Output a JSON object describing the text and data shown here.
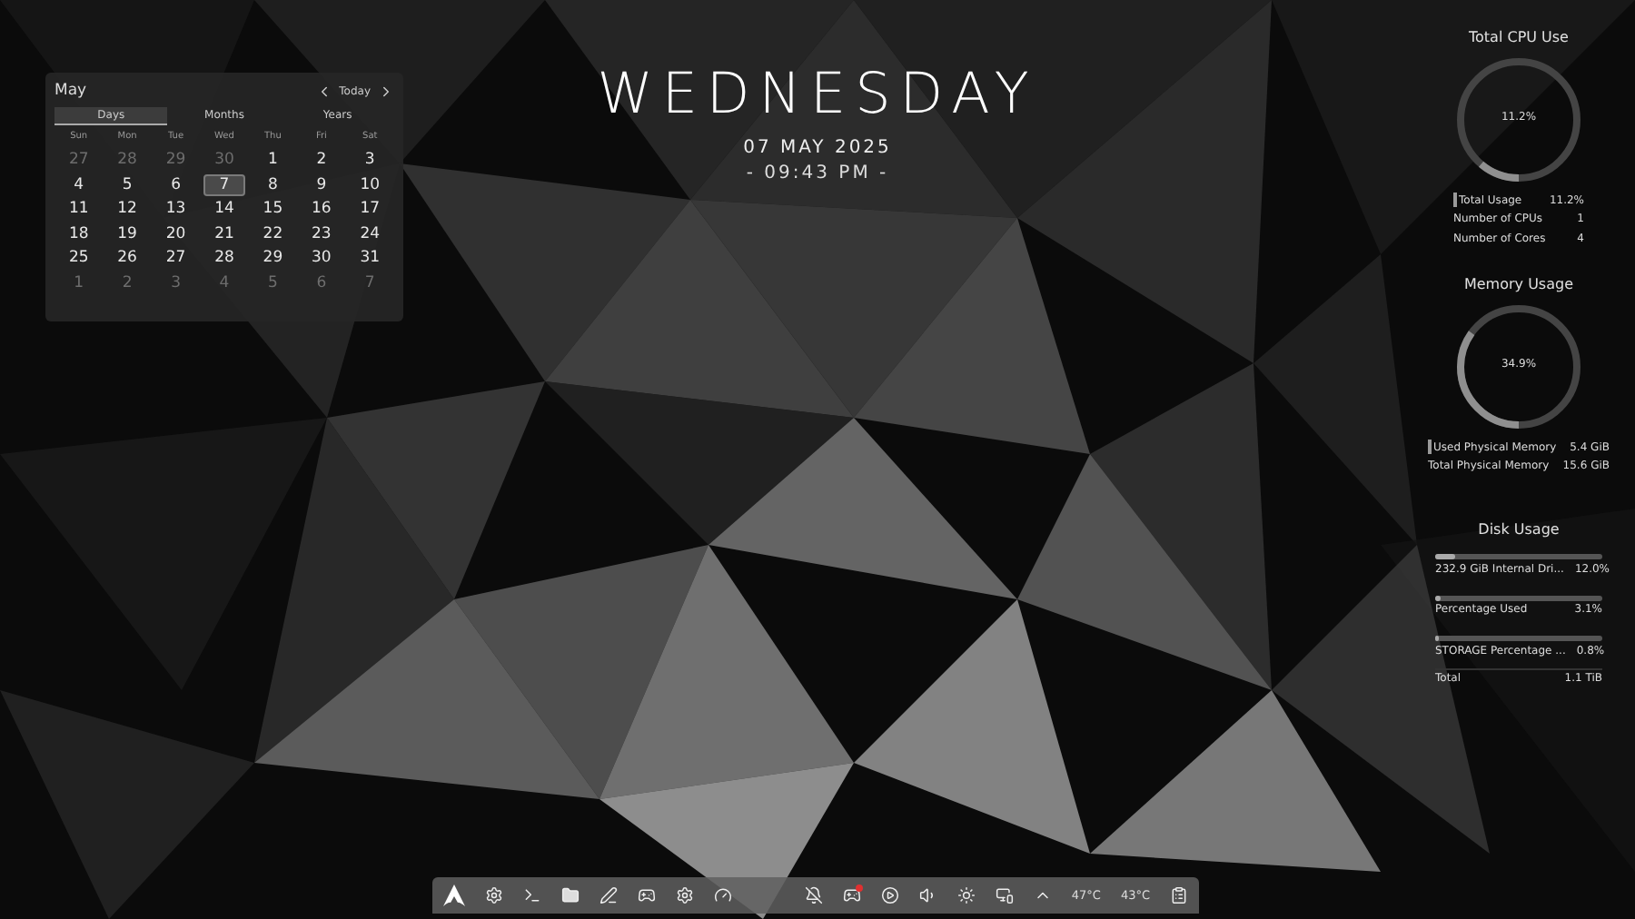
{
  "calendar": {
    "month": "May",
    "today_button": "Today",
    "views": [
      {
        "label": "Days",
        "selected": true
      },
      {
        "label": "Months",
        "selected": false
      },
      {
        "label": "Years",
        "selected": false
      }
    ],
    "weekdays": [
      "Sun",
      "Mon",
      "Tue",
      "Wed",
      "Thu",
      "Fri",
      "Sat"
    ],
    "weeks": [
      [
        {
          "day": "27",
          "dimmed": true,
          "selected": false
        },
        {
          "day": "28",
          "dimmed": true,
          "selected": false
        },
        {
          "day": "29",
          "dimmed": true,
          "selected": false
        },
        {
          "day": "30",
          "dimmed": true,
          "selected": false
        },
        {
          "day": "1",
          "dimmed": false,
          "selected": false
        },
        {
          "day": "2",
          "dimmed": false,
          "selected": false
        },
        {
          "day": "3",
          "dimmed": false,
          "selected": false
        }
      ],
      [
        {
          "day": "4",
          "dimmed": false,
          "selected": false
        },
        {
          "day": "5",
          "dimmed": false,
          "selected": false
        },
        {
          "day": "6",
          "dimmed": false,
          "selected": false
        },
        {
          "day": "7",
          "dimmed": false,
          "selected": true
        },
        {
          "day": "8",
          "dimmed": false,
          "selected": false
        },
        {
          "day": "9",
          "dimmed": false,
          "selected": false
        },
        {
          "day": "10",
          "dimmed": false,
          "selected": false
        }
      ],
      [
        {
          "day": "11",
          "dimmed": false,
          "selected": false
        },
        {
          "day": "12",
          "dimmed": false,
          "selected": false
        },
        {
          "day": "13",
          "dimmed": false,
          "selected": false
        },
        {
          "day": "14",
          "dimmed": false,
          "selected": false
        },
        {
          "day": "15",
          "dimmed": false,
          "selected": false
        },
        {
          "day": "16",
          "dimmed": false,
          "selected": false
        },
        {
          "day": "17",
          "dimmed": false,
          "selected": false
        }
      ],
      [
        {
          "day": "18",
          "dimmed": false,
          "selected": false
        },
        {
          "day": "19",
          "dimmed": false,
          "selected": false
        },
        {
          "day": "20",
          "dimmed": false,
          "selected": false
        },
        {
          "day": "21",
          "dimmed": false,
          "selected": false
        },
        {
          "day": "22",
          "dimmed": false,
          "selected": false
        },
        {
          "day": "23",
          "dimmed": false,
          "selected": false
        },
        {
          "day": "24",
          "dimmed": false,
          "selected": false
        }
      ],
      [
        {
          "day": "25",
          "dimmed": false,
          "selected": false
        },
        {
          "day": "26",
          "dimmed": false,
          "selected": false
        },
        {
          "day": "27",
          "dimmed": false,
          "selected": false
        },
        {
          "day": "28",
          "dimmed": false,
          "selected": false
        },
        {
          "day": "29",
          "dimmed": false,
          "selected": false
        },
        {
          "day": "30",
          "dimmed": false,
          "selected": false
        },
        {
          "day": "31",
          "dimmed": false,
          "selected": false
        }
      ],
      [
        {
          "day": "1",
          "dimmed": true,
          "selected": false
        },
        {
          "day": "2",
          "dimmed": true,
          "selected": false
        },
        {
          "day": "3",
          "dimmed": true,
          "selected": false
        },
        {
          "day": "4",
          "dimmed": true,
          "selected": false
        },
        {
          "day": "5",
          "dimmed": true,
          "selected": false
        },
        {
          "day": "6",
          "dimmed": true,
          "selected": false
        },
        {
          "day": "7",
          "dimmed": true,
          "selected": false
        }
      ]
    ]
  },
  "clock": {
    "day": "WEDNESDAY",
    "date": "07 MAY 2025",
    "time": "- 09:43 PM -"
  },
  "cpu": {
    "title": "Total CPU Use",
    "reading": "11.2%",
    "level": 0.112,
    "rows": [
      {
        "label": "Total Usage",
        "value": "11.2%",
        "swatch": true
      },
      {
        "label": "Number of CPUs",
        "value": "1",
        "swatch": false
      },
      {
        "label": "Number of Cores",
        "value": "4",
        "swatch": false
      }
    ]
  },
  "memory": {
    "title": "Memory Usage",
    "reading": "34.9%",
    "level": 0.349,
    "rows": [
      {
        "label": "Used Physical Memory",
        "value": "5.4 GiB",
        "swatch": true
      },
      {
        "label": "Total Physical Memory",
        "value": "15.6 GiB",
        "swatch": false
      }
    ]
  },
  "disk": {
    "title": "Disk Usage",
    "rows": [
      {
        "label": "232.9 GiB Internal Dri...",
        "value": "12.0%",
        "level": 0.12
      },
      {
        "label": "Percentage Used",
        "value": "3.1%",
        "level": 0.031
      },
      {
        "label": "STORAGE Percentage ...",
        "value": "0.8%",
        "level": 0.008
      }
    ],
    "total": {
      "label": "Total",
      "value": "1.1 TiB"
    }
  },
  "taskbar": {
    "chat_badge": true,
    "temperatures": [
      "47°C",
      "43°C"
    ]
  }
}
